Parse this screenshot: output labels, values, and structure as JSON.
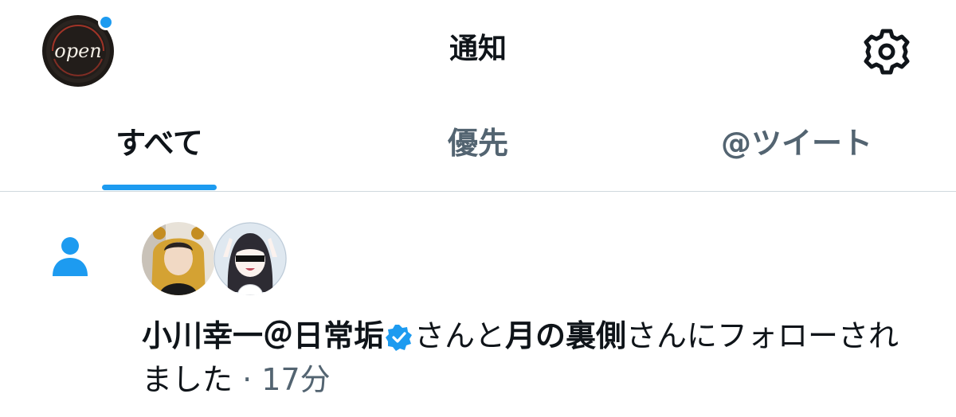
{
  "header": {
    "title": "通知",
    "avatar_icon": "open-neon-sign-avatar",
    "avatar_text": "open",
    "settings_icon": "gear-icon",
    "accent_color": "#1d9bf0"
  },
  "tabs": [
    {
      "label": "すべて",
      "active": true
    },
    {
      "label": "優先",
      "active": false
    },
    {
      "label": "@ツイート",
      "active": false
    }
  ],
  "notification": {
    "type_icon": "person-icon",
    "actors": [
      {
        "name": "小川幸一＠日常垢",
        "verified": true,
        "avatar": "photo-avatar"
      },
      {
        "name": "月の裏側",
        "verified": false,
        "avatar": "anime-girl-avatar"
      }
    ],
    "text_and": "さんと",
    "text_suffix": "さんにフォローされました",
    "separator": " · ",
    "time": "17分"
  }
}
